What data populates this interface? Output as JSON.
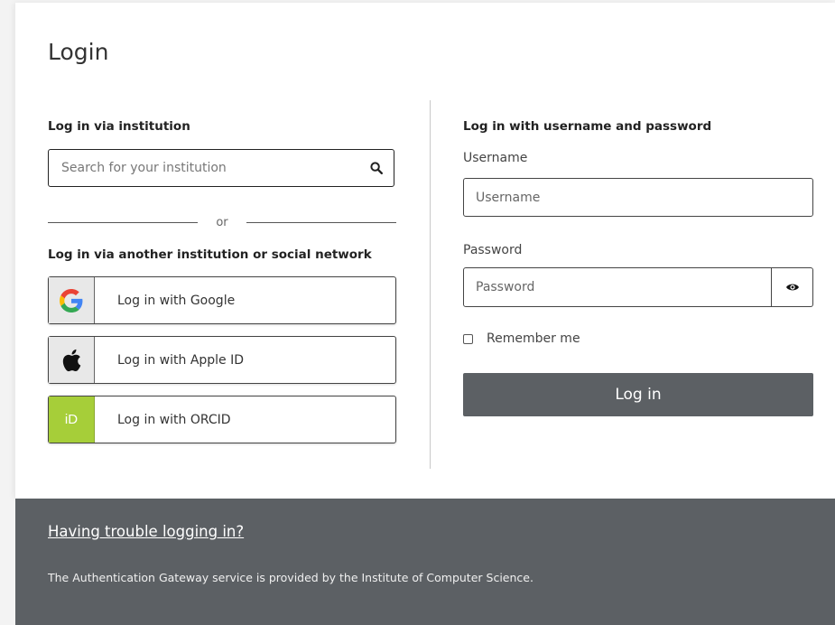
{
  "page": {
    "title": "Login"
  },
  "left": {
    "institution_heading": "Log in via institution",
    "search_placeholder": "Search for your institution",
    "or_text": "or",
    "social_heading": "Log in via another institution or social network",
    "social_buttons": [
      {
        "label": "Log in with Google",
        "icon": "google-icon"
      },
      {
        "label": "Log in with Apple ID",
        "icon": "apple-icon"
      },
      {
        "label": "Log in with ORCID",
        "icon": "orcid-icon",
        "icon_text": "iD"
      }
    ]
  },
  "right": {
    "heading": "Log in with username and password",
    "username_label": "Username",
    "username_placeholder": "Username",
    "password_label": "Password",
    "password_placeholder": "Password",
    "remember_label": "Remember me",
    "login_button": "Log in"
  },
  "footer": {
    "trouble_link": "Having trouble logging in?",
    "note": "The Authentication Gateway service is provided by the Institute of Computer Science."
  },
  "colors": {
    "footer_bg": "#5c6064",
    "login_button_bg": "#5c6064",
    "orcid_green": "#a6ce39"
  }
}
